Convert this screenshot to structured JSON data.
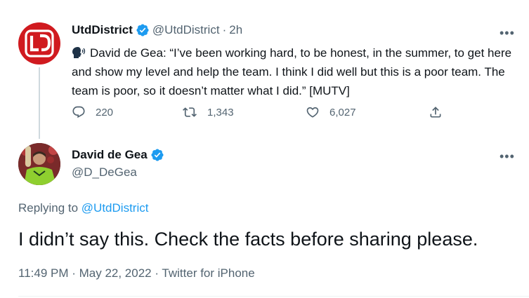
{
  "tweet1": {
    "author_name": "UtdDistrict",
    "handle": "@UtdDistrict",
    "separator": "·",
    "time": "2h",
    "text": "David de Gea: “I’ve been working hard, to be honest, in the summer, to get here and show my level and help the team. I think I did well but this is a poor team. The team is poor, so it doesn’t matter what I did.” [MUTV]",
    "avatar_letters": "UD",
    "replies": "220",
    "retweets": "1,343",
    "likes": "6,027"
  },
  "tweet2": {
    "author_name": "David de Gea",
    "handle": "@D_DeGea",
    "replying_prefix": "Replying to",
    "replying_to": "@UtdDistrict",
    "text": "I didn’t say this. Check the facts before sharing please.",
    "meta": "11:49 PM · May 22, 2022 · Twitter for iPhone"
  },
  "more_label": "•••",
  "icons": {
    "verified": "verified-badge-icon",
    "reply": "reply-icon",
    "retweet": "retweet-icon",
    "like": "heart-icon",
    "share": "share-icon",
    "speaking": "speaking-head-icon"
  },
  "colors": {
    "brand_blue": "#1d9bf0",
    "secondary_text": "#536471",
    "primary_text": "#0f1419",
    "ud_red": "#d01a1f"
  }
}
